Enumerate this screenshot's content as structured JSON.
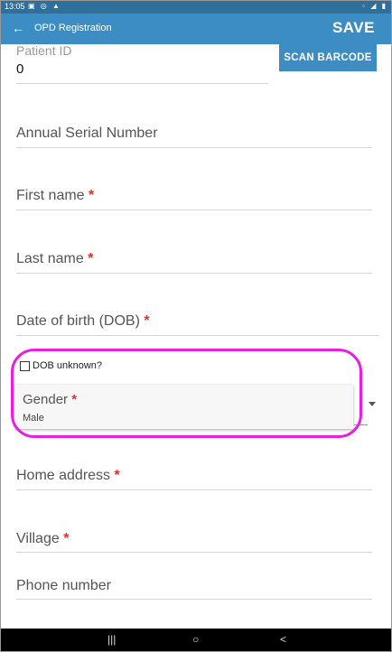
{
  "status_bar": {
    "time": "13:05",
    "left_icons": "▣ ◎ ▲",
    "right_icons": "◦ ◢ ▮"
  },
  "app_bar": {
    "back_icon": "←",
    "title": "OPD Registration",
    "save_label": "SAVE"
  },
  "scan_button": {
    "label": "SCAN BARCODE"
  },
  "form": {
    "patient_id": {
      "label": "Patient ID",
      "value": "0"
    },
    "annual_serial": {
      "label": "Annual Serial Number"
    },
    "first_name": {
      "label": "First name",
      "required": "*"
    },
    "last_name": {
      "label": "Last name",
      "required": "*"
    },
    "dob": {
      "label": "Date of birth (DOB)",
      "required": "*"
    },
    "dob_unknown": {
      "label": "DOB unknown?",
      "checked": false
    },
    "gender": {
      "label": "Gender",
      "required": "*",
      "value": "Male"
    },
    "home_address": {
      "label": "Home address",
      "required": "*"
    },
    "village": {
      "label": "Village",
      "required": "*"
    },
    "phone": {
      "label": "Phone number"
    }
  },
  "nav_bar": {
    "recents_icon": "|||",
    "home_icon": "○",
    "back_icon": "<"
  },
  "colors": {
    "app_bar": "#3b8dc3",
    "status_bar": "#2f6f99",
    "required": "#e0302f",
    "highlight": "#e81ee0"
  }
}
